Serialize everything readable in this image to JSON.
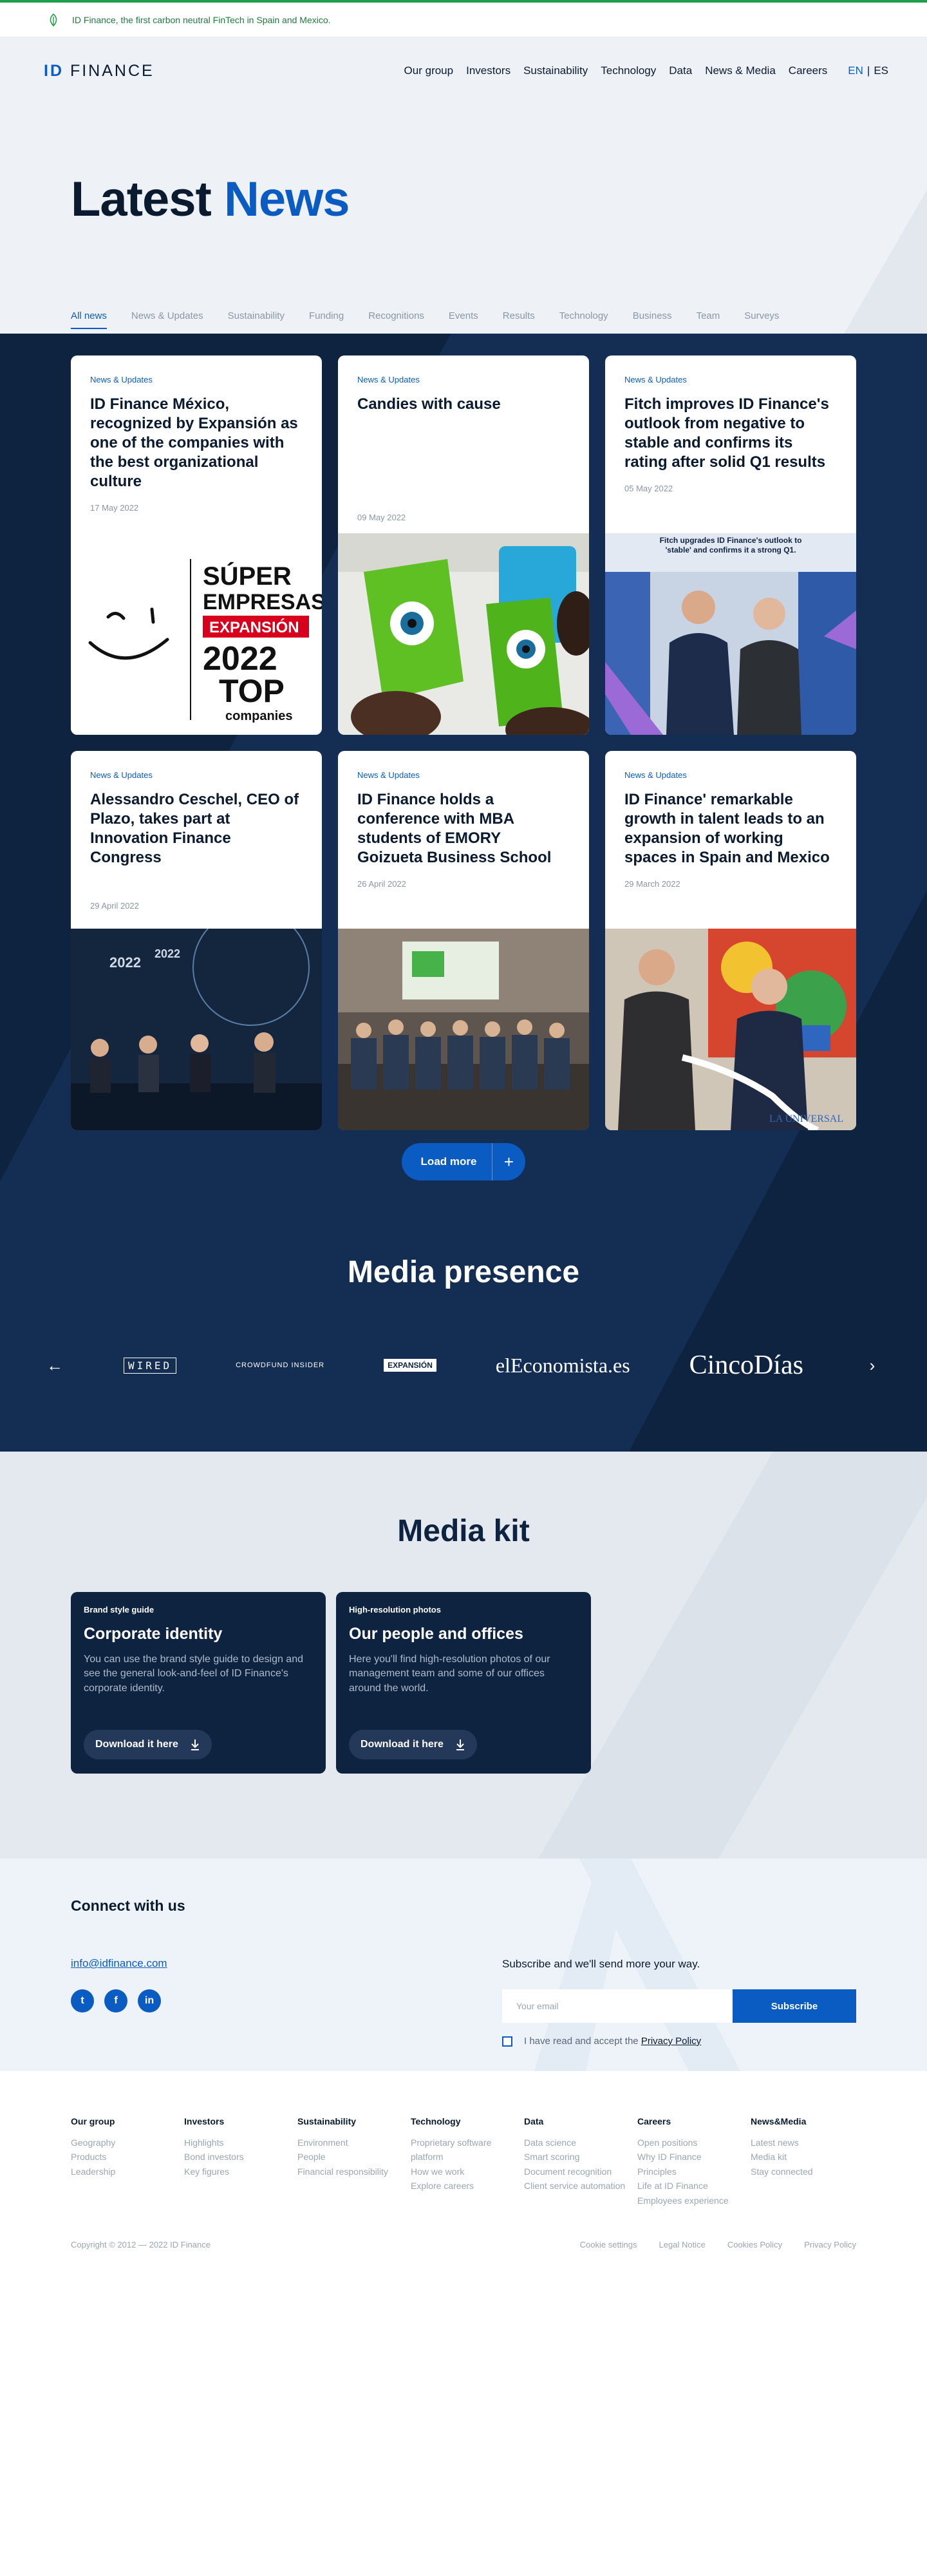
{
  "announcement": {
    "text": "ID Finance, the first carbon neutral FinTech in Spain and Mexico."
  },
  "header": {
    "logo_prefix": "ID",
    "logo_rest": "FINANCE",
    "menu": [
      "Our group",
      "Investors",
      "Sustainability",
      "Technology",
      "Data",
      "News & Media",
      "Careers"
    ],
    "lang_active": "EN",
    "lang_sep": "|",
    "lang_other": "ES"
  },
  "page": {
    "title_part1": "Latest",
    "title_part2": "News"
  },
  "tabs": [
    "All news",
    "News & Updates",
    "Sustainability",
    "Funding",
    "Recognitions",
    "Events",
    "Results",
    "Technology",
    "Business",
    "Team",
    "Surveys"
  ],
  "active_tab": "All news",
  "news": [
    {
      "category": "News & Updates",
      "title": "ID Finance México, recognized by Expansión as one of the companies with the best organizational culture",
      "date": "17 May 2022",
      "image": {
        "top": "SÚPER",
        "mid": "EMPRESAS",
        "brand": "EXPANSIÓN",
        "year": "2022",
        "rank": "TOP",
        "sub": "companies"
      }
    },
    {
      "category": "News & Updates",
      "title": "Candies with cause",
      "date": "09 May 2022"
    },
    {
      "category": "News & Updates",
      "title": "Fitch improves ID Finance's outlook from negative to stable and confirms its rating after solid Q1 results",
      "date": "05 May 2022",
      "image": {
        "banner": "Fitch upgrades ID Finance's outlook to 'stable' and confirms it a strong Q1."
      }
    },
    {
      "category": "News & Updates",
      "title": "Alessandro Ceschel, CEO of Plazo, takes part at Innovation Finance Congress",
      "date": "29 April 2022",
      "image": {
        "year_a": "2022",
        "year_b": "2022"
      }
    },
    {
      "category": "News & Updates",
      "title": "ID Finance holds a conference with MBA students of EMORY Goizueta Business School",
      "date": "26 April 2022"
    },
    {
      "category": "News & Updates",
      "title": "ID Finance' remarkable growth in talent leads to an expansion of working spaces in Spain and Mexico",
      "date": "29 March 2022",
      "image": {
        "watermark": "LA UNIVERSAL"
      }
    }
  ],
  "load_more": {
    "label": "Load more",
    "icon": "+"
  },
  "media_presence": {
    "title": "Media presence",
    "logos": [
      "WIRED",
      "CROWDFUND INSIDER",
      "EXPANSIÓN",
      "elEconomista.es",
      "CincoDías"
    ]
  },
  "media_kit": {
    "title": "Media kit",
    "cards": [
      {
        "label": "Brand style guide",
        "title": "Corporate identity",
        "desc": "You can use the brand style guide to design and see the general look-and-feel of ID Finance's corporate identity.",
        "button": "Download it here"
      },
      {
        "label": "High-resolution photos",
        "title": "Our people and offices",
        "desc": "Here you'll find high-resolution photos of our management team and some of our offices around the world.",
        "button": "Download it here"
      }
    ]
  },
  "connect": {
    "title": "Connect with us",
    "email": "info@idfinance.com",
    "social": [
      "t",
      "f",
      "in"
    ],
    "subscribe_text": "Subscribe and we'll send more your way.",
    "email_placeholder": "Your email",
    "subscribe_button": "Subscribe",
    "consent_text": "I have read and accept the",
    "privacy_link": "Privacy Policy"
  },
  "footer": {
    "columns": [
      {
        "title": "Our group",
        "links": [
          "Geography",
          "Products",
          "Leadership"
        ]
      },
      {
        "title": "Investors",
        "links": [
          "Highlights",
          "Bond investors",
          "Key figures"
        ]
      },
      {
        "title": "Sustainability",
        "links": [
          "Environment",
          "People",
          "Financial responsibility"
        ]
      },
      {
        "title": "Technology",
        "links": [
          "Proprietary software platform",
          "How we work",
          "Explore careers"
        ]
      },
      {
        "title": "Data",
        "links": [
          "Data science",
          "Smart scoring",
          "Document recognition",
          "Client service automation"
        ]
      },
      {
        "title": "Careers",
        "links": [
          "Open positions",
          "Why ID Finance",
          "Principles",
          "Life at ID Finance",
          "Employees experience"
        ]
      },
      {
        "title": "News&Media",
        "links": [
          "Latest news",
          "Media kit",
          "Stay connected"
        ]
      }
    ],
    "copyright": "Copyright © 2012 — 2022 ID Finance",
    "legal": [
      "Cookie settings",
      "Legal Notice",
      "Cookies Policy",
      "Privacy Policy"
    ]
  },
  "colors": {
    "brand_blue": "#0b5cc2",
    "navy": "#0d2340",
    "green": "#1e9e4a"
  }
}
